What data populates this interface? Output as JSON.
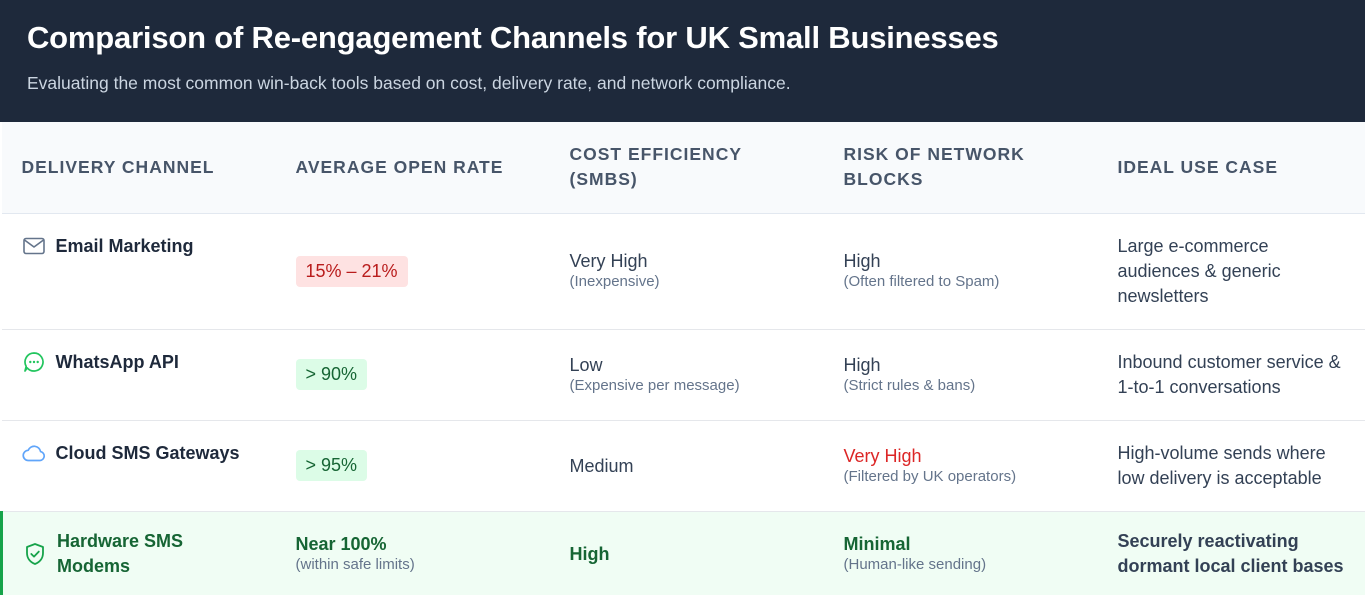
{
  "header": {
    "title": "Comparison of Re-engagement Channels for UK Small Businesses",
    "subtitle": "Evaluating the most common win-back tools based on cost, delivery rate, and network compliance."
  },
  "columns": [
    "DELIVERY CHANNEL",
    "AVERAGE OPEN RATE",
    "COST EFFICIENCY (SMBS)",
    "RISK OF NETWORK BLOCKS",
    "IDEAL USE CASE"
  ],
  "rows": [
    {
      "channel": "Email Marketing",
      "icon": "mail-icon",
      "open_rate": "15% – 21%",
      "cost": "Very High",
      "cost_note": "(Inexpensive)",
      "risk": "High",
      "risk_note": "(Often filtered to Spam)",
      "use_case": "Large e-commerce audiences & generic newsletters"
    },
    {
      "channel": "WhatsApp API",
      "icon": "chat-bubble-icon",
      "open_rate": "> 90%",
      "cost": "Low",
      "cost_note": "(Expensive per message)",
      "risk": "High",
      "risk_note": "(Strict rules & bans)",
      "use_case": "Inbound customer service & 1-to-1 conversations"
    },
    {
      "channel": "Cloud SMS Gateways",
      "icon": "cloud-icon",
      "open_rate": "> 95%",
      "cost": "Medium",
      "risk": "Very High",
      "risk_note": "(Filtered by UK operators)",
      "use_case": "High-volume sends where low delivery is acceptable"
    },
    {
      "channel": "Hardware SMS Modems",
      "icon": "shield-check-icon",
      "open_rate": "Near 100%",
      "open_rate_note": "(within safe limits)",
      "cost": "High",
      "risk": "Minimal",
      "risk_note": "(Human-like sending)",
      "use_case": "Securely reactivating dormant local client bases"
    }
  ],
  "colors": {
    "header_bg": "#1e293b",
    "highlight_row_bg": "#f0fdf4",
    "highlight_accent": "#16a34a",
    "danger": "#dc2626",
    "badge_red_bg": "#fee2e2",
    "badge_green_bg": "#dcfce7"
  }
}
